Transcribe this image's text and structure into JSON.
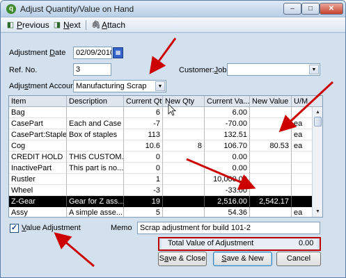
{
  "window": {
    "title": "Adjust Quantity/Value on Hand",
    "app_icon": "quickbooks-logo-icon",
    "controls": {
      "minimize": "–",
      "maximize": "□",
      "close": "✕"
    }
  },
  "toolbar": {
    "previous": "Previous",
    "next": "Next",
    "attach": "Attach"
  },
  "form": {
    "adjustment_date_label": "Adjustment Date",
    "adjustment_date": "02/09/2010",
    "ref_no_label": "Ref. No.",
    "ref_no": "3",
    "customer_job_label": "Customer:Job",
    "customer_job": "",
    "adjustment_account_label": "Adjustment Account",
    "adjustment_account": "Manufacturing Scrap"
  },
  "grid": {
    "columns": [
      "Item",
      "Description",
      "Current Qty",
      "New Qty",
      "Current Va...",
      "New Value",
      "U/M"
    ],
    "rows": [
      {
        "item": "Bag",
        "description": "",
        "current_qty": "6",
        "new_qty": "",
        "current_value": "6.00",
        "new_value": "",
        "um": ""
      },
      {
        "item": "CasePart",
        "description": "Each and Case",
        "current_qty": "-7",
        "new_qty": "",
        "current_value": "-70.00",
        "new_value": "",
        "um": "ea"
      },
      {
        "item": "CasePart:Staples",
        "description": "Box of staples",
        "current_qty": "113",
        "new_qty": "",
        "current_value": "132.51",
        "new_value": "",
        "um": "ea"
      },
      {
        "item": "Cog",
        "description": "",
        "current_qty": "10.6",
        "new_qty": "8",
        "current_value": "106.70",
        "new_value": "80.53",
        "um": "ea"
      },
      {
        "item": "CREDIT HOLD",
        "description": "THIS CUSTOM...",
        "current_qty": "0",
        "new_qty": "",
        "current_value": "0.00",
        "new_value": "",
        "um": ""
      },
      {
        "item": "InactivePart",
        "description": "This part is no...",
        "current_qty": "0",
        "new_qty": "",
        "current_value": "0.00",
        "new_value": "",
        "um": ""
      },
      {
        "item": "Rustler",
        "description": "",
        "current_qty": "1",
        "new_qty": "",
        "current_value": "10,000.00",
        "new_value": "",
        "um": ""
      },
      {
        "item": "Wheel",
        "description": "",
        "current_qty": "-3",
        "new_qty": "",
        "current_value": "-33.00",
        "new_value": "",
        "um": ""
      },
      {
        "item": "Z-Gear",
        "description": "Gear for Z ass...",
        "current_qty": "19",
        "new_qty": "",
        "current_value": "2,516.00",
        "new_value": "2,542.17",
        "um": "",
        "selected": true
      },
      {
        "item": "Assy",
        "description": "A simple asse...",
        "current_qty": "5",
        "new_qty": "",
        "current_value": "54.36",
        "new_value": "",
        "um": "ea"
      }
    ]
  },
  "footer": {
    "value_adjustment_label": "Value Adjustment",
    "value_adjustment_checked": true,
    "memo_label": "Memo",
    "memo": "Scrap adjustment for build 101-2",
    "total_label": "Total Value of Adjustment",
    "total_value": "0.00"
  },
  "buttons": {
    "save_close": "Save & Close",
    "save_new": "Save & New",
    "cancel": "Cancel"
  },
  "colors": {
    "annotation_red": "#cc0000",
    "selected_row_bg": "#000000",
    "form_bg": "#d3e0ee"
  }
}
